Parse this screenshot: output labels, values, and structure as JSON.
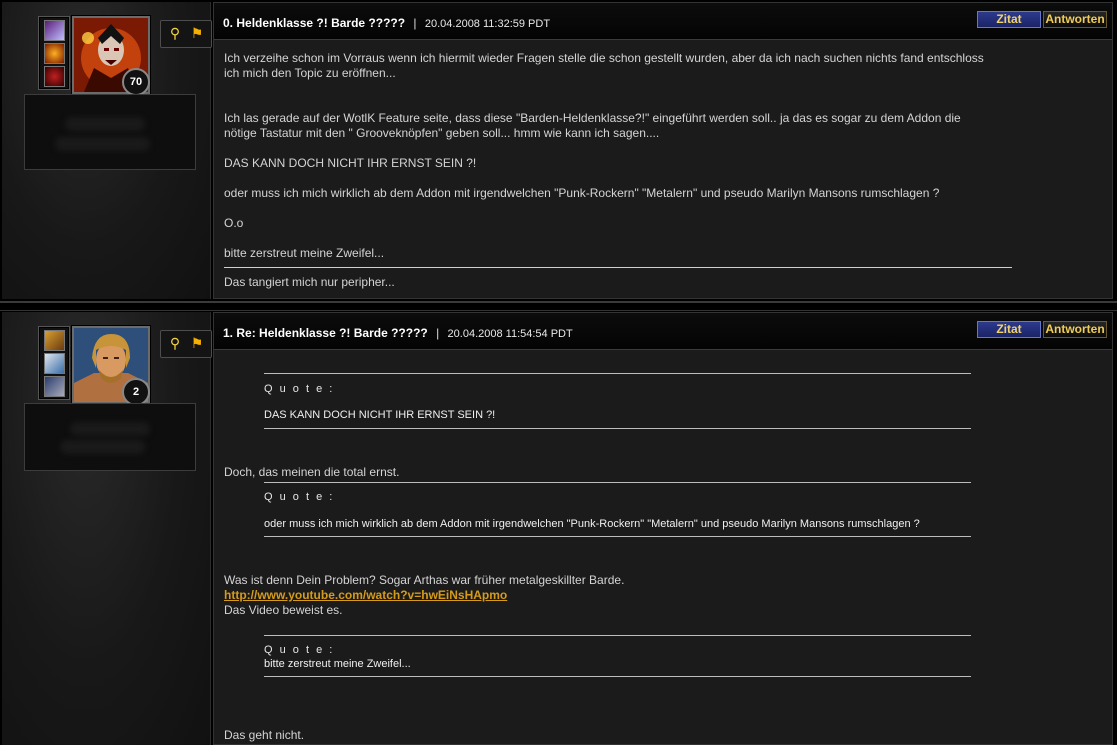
{
  "posts": [
    {
      "number": "0.",
      "subject": "Heldenklasse ?! Barde ?????",
      "date": "20.04.2008 11:32:59 PDT",
      "level": "70",
      "quote_button": "Zitat",
      "reply_button": "Antworten",
      "lines": [
        "Ich verzeihe schon im Vorraus wenn ich hiermit wieder Fragen stelle die schon gestellt wurden, aber da ich nach suchen nichts fand entschloss",
        "ich mich den Topic zu eröffnen...",
        "Ich las gerade auf der WotlK Feature seite, dass diese \"Barden-Heldenklasse?!\" eingeführt werden soll.. ja das es sogar zu dem Addon die",
        "nötige Tastatur mit den \" Grooveknöpfen\" geben soll... hmm wie kann ich sagen....",
        "DAS KANN DOCH NICHT IHR ERNST SEIN ?!",
        "oder muss ich mich wirklich ab dem Addon mit irgendwelchen \"Punk-Rockern\" \"Metalern\" und pseudo Marilyn Mansons rumschlagen ?",
        "O.o",
        "bitte zerstreut meine Zweifel..."
      ],
      "signature": "Das tangiert mich nur peripher..."
    },
    {
      "number": "1.",
      "subject": "Re: Heldenklasse ?! Barde ?????",
      "date": "20.04.2008 11:54:54 PDT",
      "level": "2",
      "quote_button": "Zitat",
      "reply_button": "Antworten",
      "quote_label": "Q u o t e :",
      "quote1": "DAS KANN DOCH NICHT IHR ERNST SEIN ?!",
      "reply1": "Doch, das meinen die total ernst.",
      "quote2": "oder muss ich mich wirklich ab dem Addon mit irgendwelchen \"Punk-Rockern\" \"Metalern\" und pseudo Marilyn Mansons rumschlagen ?",
      "reply2_line1": "Was ist denn Dein Problem? Sogar Arthas war früher metalgeskillter Barde.",
      "reply2_link": "http://www.youtube.com/watch?v=hwEiNsHApmo",
      "reply2_line2": "Das Video beweist es.",
      "quote3": "bitte zerstreut meine Zweifel...",
      "reply3": "Das geht nicht."
    }
  ],
  "colors": {
    "link": "#d79b1b",
    "zitat_bg": "#2d3a8c",
    "button_text": "#f2d36a"
  }
}
